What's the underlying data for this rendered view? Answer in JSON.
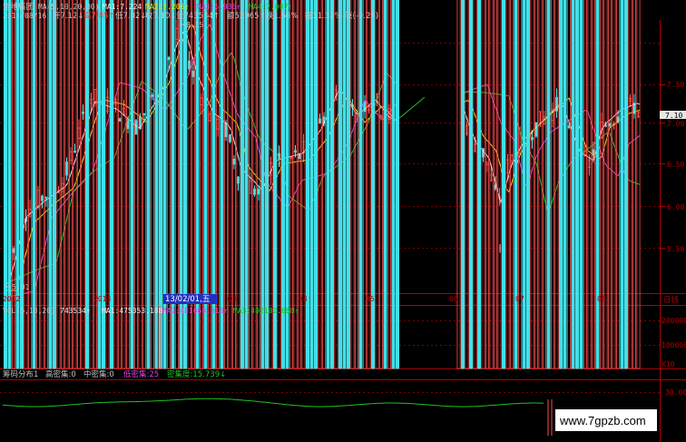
{
  "header": {
    "name": "金地集团",
    "ma_label": "MA(5,10,20,30)",
    "ma1": "MA1:7.224",
    "ma2": "MA2:7.206↑",
    "ma3": "MA3:6.936↑",
    "ma4": "MA4:7.007↑",
    "date": "2013/08/16",
    "open": "开7.12↓",
    "high": "高7.85↑",
    "low": "低7.02↓",
    "close": "收7.10↓",
    "volume": "量743534↑",
    "amount": "额53965↑",
    "turnover": "换1.66%",
    "amplitude": "振11.32%",
    "change": "涨(-0.28)"
  },
  "colors": {
    "up": "#ff4d4d",
    "down": "#40e0e8",
    "axis": "#b00000",
    "ma1": "#e8e8e8",
    "ma2": "#e8e000",
    "ma3": "#e040e0",
    "ma4": "#20c020",
    "text_gray": "#c0c0c0"
  },
  "price_panel": {
    "annotations": {
      "high_mark": "8.25",
      "low_mark": "5.01"
    },
    "current_price": "7.10",
    "y_ticks": [
      "7.50",
      "7.00",
      "6.50",
      "6.00",
      "5.50"
    ]
  },
  "time_axis": {
    "labels": [
      "2012",
      "2013",
      "13/02/01,五",
      "03",
      "04",
      "05",
      "06",
      "07",
      "08"
    ],
    "period_label": "日线"
  },
  "volume_panel": {
    "title": "VOL(5,10,20)",
    "value": "743534↑",
    "ma1": "MA1:475353.188↑",
    "ma2": "MA2:481668.313↑",
    "ma3": "MA3:492182.688↑",
    "y_ticks": [
      "200000",
      "100000"
    ],
    "unit": "X10"
  },
  "chip_panel": {
    "title": "筹码分布1",
    "high_conc": "高密集:0",
    "mid_conc": "中密集:0",
    "low_conc": "低密集:25",
    "density": "密集度:15.739↓",
    "y_tick": "30.00"
  },
  "watermark": "www.7gpzb.com",
  "chart_data": [
    {
      "type": "candlestick",
      "title": "金地集团",
      "ylim": [
        5.0,
        8.3
      ],
      "y_ticks": [
        5.5,
        6.0,
        6.5,
        7.0,
        7.5
      ],
      "annotations": [
        {
          "text": "8.25",
          "value": 8.25
        },
        {
          "text": "5.01",
          "value": 5.01
        }
      ],
      "last_close": 7.1,
      "moving_averages": {
        "MA5": 7.224,
        "MA10": 7.206,
        "MA20": 6.936,
        "MA30": 7.007
      }
    },
    {
      "type": "bar",
      "title": "VOL(5,10,20)",
      "ylim": [
        0,
        250000
      ],
      "y_ticks": [
        100000,
        200000
      ],
      "last_value": 743534,
      "moving_averages": {
        "MA1": 475353.188,
        "MA2": 481668.313,
        "MA3": 492182.688
      }
    },
    {
      "type": "line",
      "title": "筹码分布1",
      "y_ticks": [
        30.0
      ],
      "last_value": 15.739
    }
  ]
}
